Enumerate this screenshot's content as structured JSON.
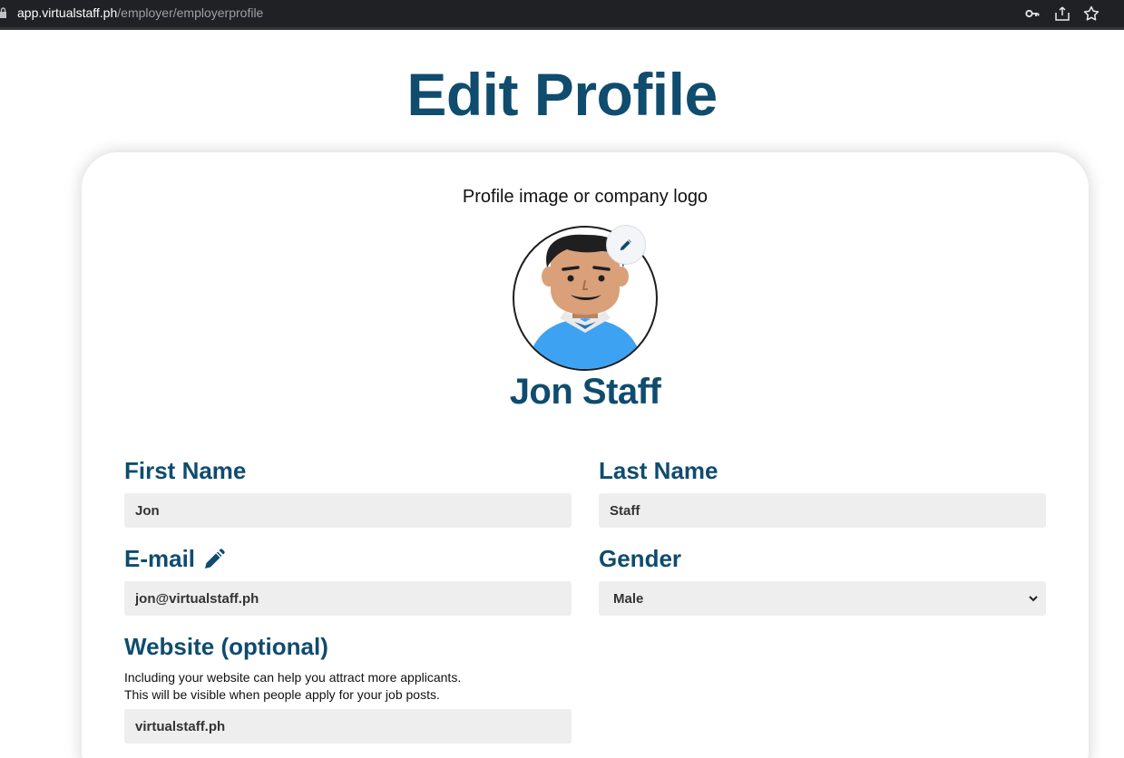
{
  "browser": {
    "url_host": "app.virtualstaff.ph",
    "url_path": "/employer/employerprofile"
  },
  "page": {
    "title": "Edit Profile"
  },
  "profile": {
    "image_label": "Profile image or company logo",
    "display_name": "Jon Staff"
  },
  "form": {
    "first_name": {
      "label": "First Name",
      "value": "Jon"
    },
    "last_name": {
      "label": "Last Name",
      "value": "Staff"
    },
    "email": {
      "label": "E-mail",
      "value": "jon@virtualstaff.ph"
    },
    "gender": {
      "label": "Gender",
      "value": "Male"
    },
    "website": {
      "label": "Website (optional)",
      "help_line1": "Including your website can help you attract more applicants.",
      "help_line2": "This will be visible when people apply for your job posts.",
      "value": "virtualstaff.ph"
    }
  },
  "colors": {
    "heading": "#0f4c6e",
    "input_bg": "#eeeeee",
    "browser_bar": "#202124"
  },
  "icons": [
    "lock-icon",
    "key-icon",
    "share-icon",
    "star-icon",
    "pencil-icon",
    "chevron-down-icon"
  ]
}
